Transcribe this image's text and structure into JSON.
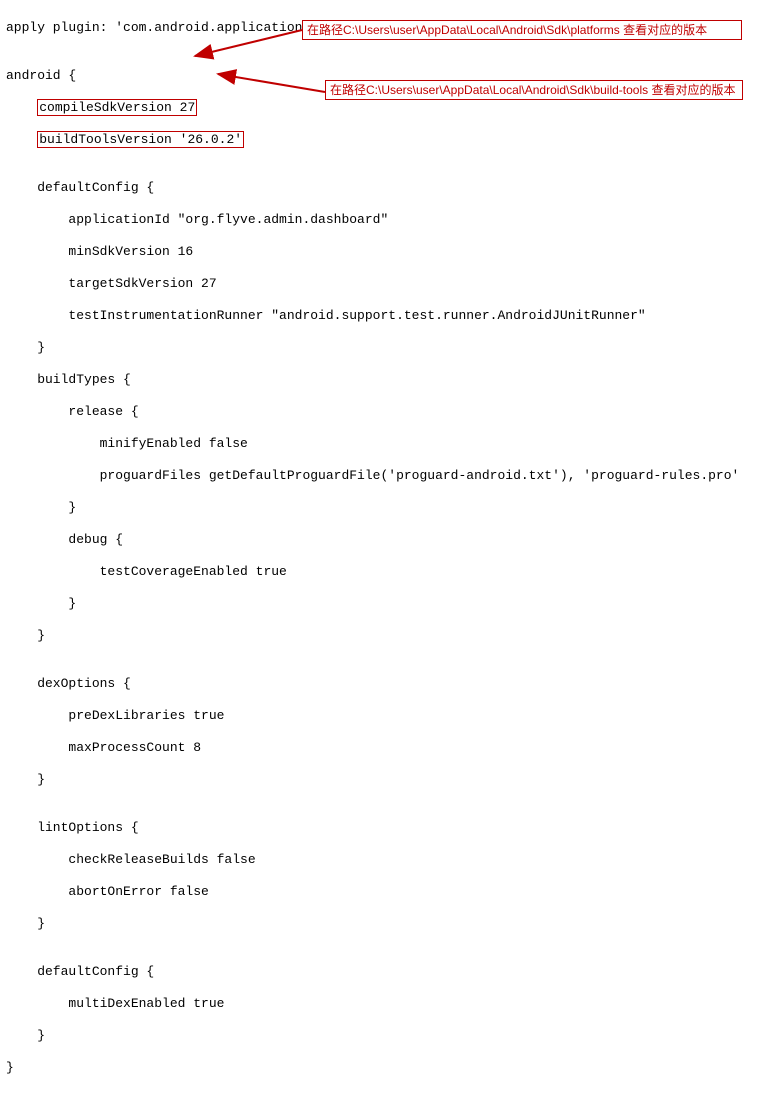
{
  "code": {
    "l0": "apply plugin: 'com.android.application'",
    "l1": "",
    "l2": "android {",
    "l3_pre": "    ",
    "l3_hl": "compileSdkVersion 27",
    "l4_pre": "    ",
    "l4_hl": "buildToolsVersion '26.0.2'",
    "l5": "",
    "l6": "    defaultConfig {",
    "l7": "        applicationId \"org.flyve.admin.dashboard\"",
    "l8": "        minSdkVersion 16",
    "l9": "        targetSdkVersion 27",
    "l10": "        testInstrumentationRunner \"android.support.test.runner.AndroidJUnitRunner\"",
    "l11": "    }",
    "l12": "    buildTypes {",
    "l13": "        release {",
    "l14": "            minifyEnabled false",
    "l15": "            proguardFiles getDefaultProguardFile('proguard-android.txt'), 'proguard-rules.pro'",
    "l16": "        }",
    "l17": "        debug {",
    "l18": "            testCoverageEnabled true",
    "l19": "        }",
    "l20": "    }",
    "l21": "",
    "l22": "    dexOptions {",
    "l23": "        preDexLibraries true",
    "l24": "        maxProcessCount 8",
    "l25": "    }",
    "l26": "",
    "l27": "    lintOptions {",
    "l28": "        checkReleaseBuilds false",
    "l29": "        abortOnError false",
    "l30": "    }",
    "l31": "",
    "l32": "    defaultConfig {",
    "l33": "        multiDexEnabled true",
    "l34": "    }",
    "l35": "}"
  },
  "annotations": {
    "callout1": "在路径C:\\Users\\user\\AppData\\Local\\Android\\Sdk\\platforms 查看对应的版本",
    "callout2": "在路径C:\\Users\\user\\AppData\\Local\\Android\\Sdk\\build-tools 查看对应的版本"
  }
}
